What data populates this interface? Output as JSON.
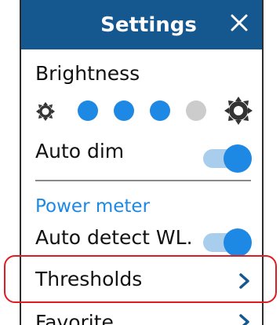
{
  "header": {
    "title": "Settings",
    "close_icon": "close-icon"
  },
  "brightness": {
    "label": "Brightness",
    "level": 3,
    "max": 4,
    "min_icon": "brightness-low-icon",
    "max_icon": "brightness-high-icon"
  },
  "auto_dim": {
    "label": "Auto dim",
    "enabled": true
  },
  "power_meter": {
    "section_title": "Power meter",
    "auto_detect_label": "Auto detect WL.",
    "auto_detect_enabled": true,
    "thresholds_label": "Thresholds",
    "favorite_label": "Favorite"
  },
  "colors": {
    "header_bg": "#15578f",
    "accent": "#1e88e5",
    "toggle_track": "#a9cdec",
    "inactive_dot": "#cccccc",
    "highlight_border": "#e11b22"
  }
}
